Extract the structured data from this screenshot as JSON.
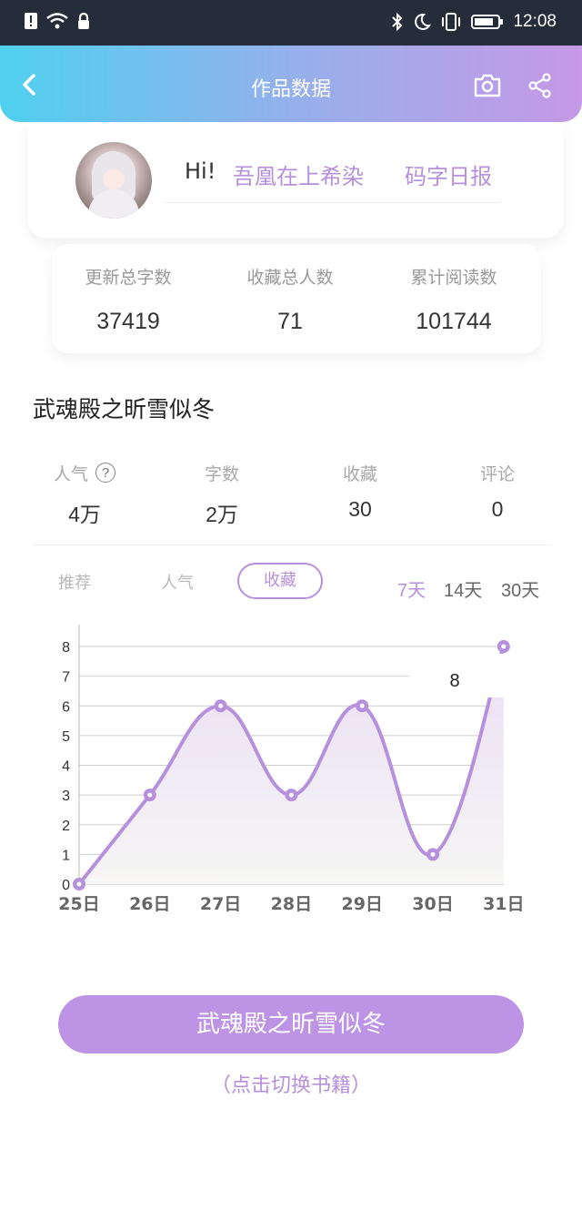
{
  "status_bar": {
    "time": "12:08"
  },
  "header": {
    "title": "作品数据"
  },
  "user": {
    "greeting": "Hi!",
    "name": "吾凰在上希染",
    "report_link": "码字日报"
  },
  "totals": [
    {
      "label": "更新总字数",
      "value": "37419"
    },
    {
      "label": "收藏总人数",
      "value": "71"
    },
    {
      "label": "累计阅读数",
      "value": "101744"
    }
  ],
  "book": {
    "title": "武魂殿之昕雪似冬"
  },
  "stats": [
    {
      "label": "人气",
      "value": "4万",
      "help_icon": "?"
    },
    {
      "label": "字数",
      "value": "2万"
    },
    {
      "label": "收藏",
      "value": "30"
    },
    {
      "label": "评论",
      "value": "0"
    }
  ],
  "metric_tabs": [
    "推荐",
    "人气",
    "收藏"
  ],
  "active_metric": "收藏",
  "range_tabs": [
    "7天",
    "14天",
    "30天"
  ],
  "active_range": "7天",
  "chart_data": {
    "type": "area",
    "categories": [
      "25日",
      "26日",
      "27日",
      "28日",
      "29日",
      "30日",
      "31日"
    ],
    "series": [
      {
        "values": [
          0,
          3,
          6,
          3,
          6,
          1,
          8
        ]
      }
    ],
    "y_ticks": [
      0,
      1,
      2,
      3,
      4,
      5,
      6,
      7,
      8
    ],
    "ylim": [
      0,
      8
    ],
    "grid": true,
    "tooltip": "8",
    "colors": {
      "line": "#b690dd",
      "fill": "#e9ddf3"
    }
  },
  "switch_button": {
    "label": "武魂殿之昕雪似冬",
    "hint": "（点击切换书籍）"
  },
  "colors": {
    "accent": "#b690dd",
    "header_from": "#4fd0ef",
    "header_to": "#c698e6"
  }
}
